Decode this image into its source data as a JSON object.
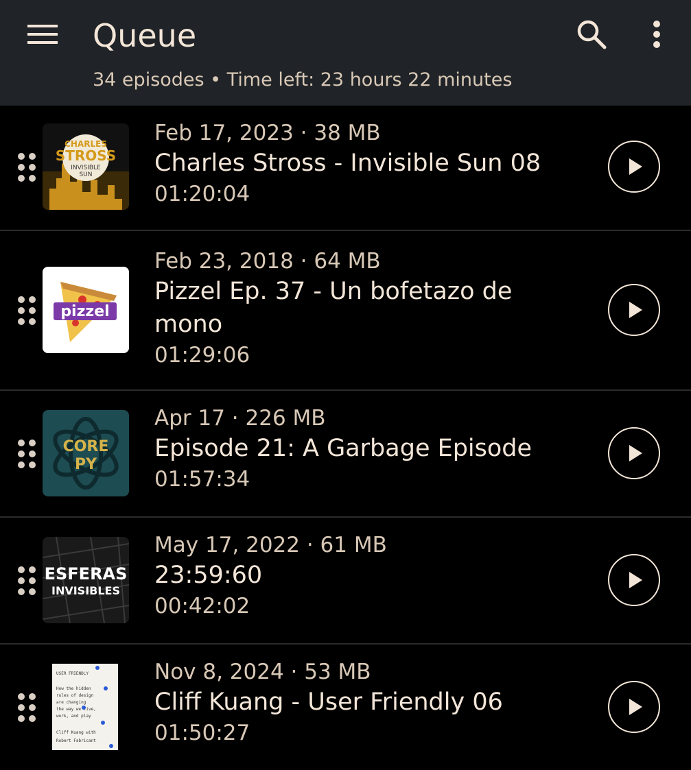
{
  "header": {
    "title": "Queue",
    "subtitle": "34 episodes • Time left: 23 hours 22 minutes",
    "icons": [
      "menu-icon",
      "search-icon",
      "more-vert-icon"
    ]
  },
  "colors": {
    "appbar": "#202327",
    "background": "#000000",
    "text_primary": "#f3e6d8",
    "text_secondary": "#d8c8b6"
  },
  "episodes": [
    {
      "date_size": "Feb 17, 2023 · 38 MB",
      "title": "Charles Stross - Invisible Sun 08",
      "duration": "01:20:04",
      "cover_art_text": [
        "CHARLES",
        "STROSS",
        "INVISIBLE",
        "SUN"
      ]
    },
    {
      "date_size": "Feb 23, 2018 · 64 MB",
      "title": "Pizzel Ep. 37 - Un bofetazo de mono",
      "duration": "01:29:06",
      "cover_art_text": [
        "pizzel"
      ]
    },
    {
      "date_size": "Apr 17 · 226 MB",
      "title": "Episode 21: A Garbage Episode",
      "duration": "01:57:34",
      "cover_art_text": [
        "CORE",
        "PY"
      ]
    },
    {
      "date_size": "May 17, 2022 · 61 MB",
      "title": "23:59:60",
      "duration": "00:42:02",
      "cover_art_text": [
        "ESFERAS",
        "INVISIBLES"
      ]
    },
    {
      "date_size": "Nov 8, 2024 · 53 MB",
      "title": "Cliff Kuang - User Friendly 06",
      "duration": "01:50:27",
      "cover_art_text": [
        "USER FRIENDLY",
        "How the hidden",
        "rules of design",
        "are changing",
        "the way we live,",
        "work, and play",
        "Cliff Kuang with",
        "Robert Fabricant"
      ]
    }
  ]
}
